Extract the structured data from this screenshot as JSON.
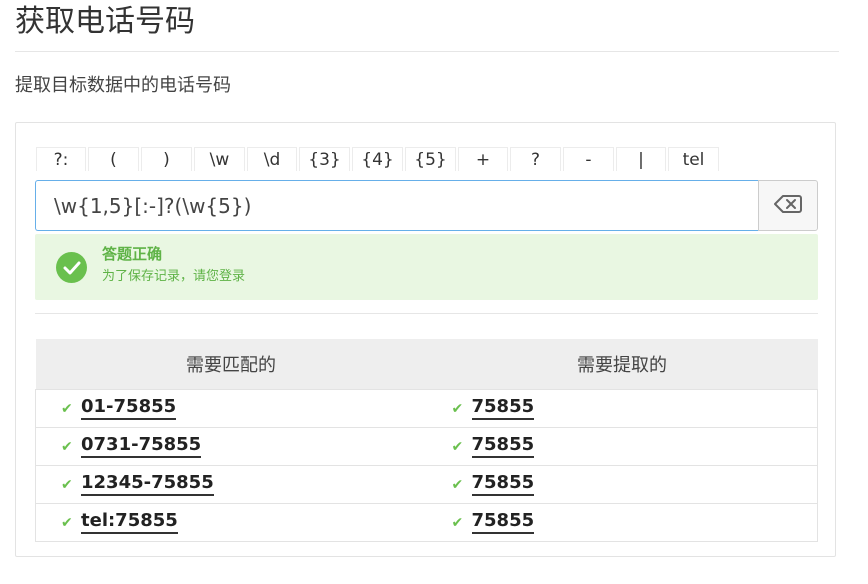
{
  "page": {
    "title": "获取电话号码",
    "subtitle": "提取目标数据中的电话号码"
  },
  "tokens": [
    "?:",
    "(",
    ")",
    "\\w",
    "\\d",
    "{3}",
    "{4}",
    "{5}",
    "+",
    "?",
    "-",
    "|",
    "tel"
  ],
  "regex": {
    "value": "\\w{1,5}[:-]?(\\w{5})"
  },
  "icons": {
    "clear": "backspace-icon",
    "success": "check-circle-icon",
    "row_status": "check-icon"
  },
  "result": {
    "title": "答题正确",
    "subtitle": "为了保存记录，请您登录"
  },
  "table": {
    "headers": [
      "需要匹配的",
      "需要提取的"
    ],
    "rows": [
      {
        "match": "01-75855",
        "extract": "75855"
      },
      {
        "match": "0731-75855",
        "extract": "75855"
      },
      {
        "match": "12345-75855",
        "extract": "75855"
      },
      {
        "match": "tel:75855",
        "extract": "75855"
      }
    ]
  },
  "colors": {
    "success": "#6ac04e",
    "success_bg": "#e9f7e2",
    "input_border": "#66afe9"
  }
}
